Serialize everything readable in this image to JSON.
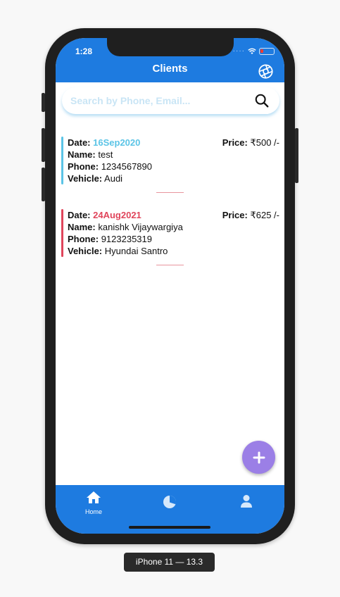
{
  "status": {
    "time": "1:28"
  },
  "header": {
    "title": "Clients"
  },
  "search": {
    "placeholder": "Search by Phone, Email..."
  },
  "labels": {
    "date": "Date:",
    "name": "Name:",
    "phone": "Phone:",
    "vehicle": "Vehicle:",
    "price": "Price:"
  },
  "clients": [
    {
      "date": "16Sep2020",
      "name": "test",
      "phone": "1234567890",
      "vehicle": "Audi",
      "price": "₹500 /-",
      "accent": "#5bc4e6"
    },
    {
      "date": "24Aug2021",
      "name": "kanishk Vijaywargiya",
      "phone": "9123235319",
      "vehicle": "Hyundai Santro",
      "price": "₹625 /-",
      "accent": "#e0455b"
    }
  ],
  "nav": {
    "home_label": "Home"
  },
  "device": {
    "label": "iPhone 11 — 13.3"
  },
  "colors": {
    "primary": "#1e7be0",
    "fab": "#9b7fe6",
    "divider": "#e8959d"
  },
  "icons": {
    "header_action": "aperture-icon",
    "search": "search-icon",
    "fab": "plus-icon",
    "nav": [
      "home-icon",
      "pie-chart-icon",
      "person-icon"
    ]
  }
}
